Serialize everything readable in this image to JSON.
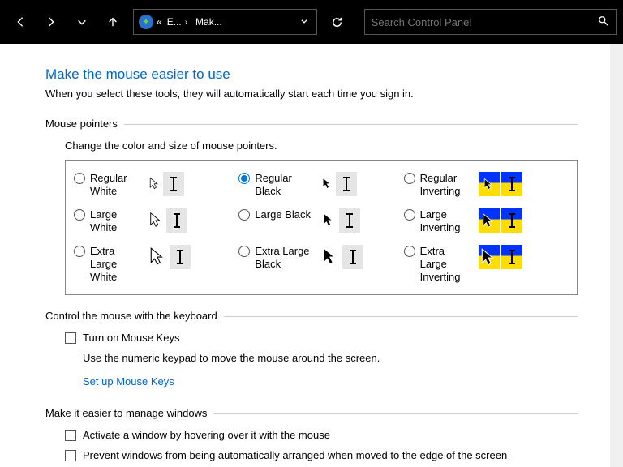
{
  "toolbar": {
    "breadcrumb1": "E...",
    "breadcrumb2": "Mak...",
    "search_placeholder": "Search Control Panel"
  },
  "page": {
    "title": "Make the mouse easier to use",
    "subtitle": "When you select these tools, they will automatically start each time you sign in."
  },
  "pointers": {
    "legend": "Mouse pointers",
    "instruction": "Change the color and size of mouse pointers.",
    "selected": "regular_black",
    "options": {
      "regular_white": "Regular White",
      "regular_black": "Regular Black",
      "regular_inverting": "Regular Inverting",
      "large_white": "Large White",
      "large_black": "Large Black",
      "large_inverting": "Large Inverting",
      "xl_white": "Extra Large White",
      "xl_black": "Extra Large Black",
      "xl_inverting": "Extra Large Inverting"
    }
  },
  "keyboard": {
    "legend": "Control the mouse with the keyboard",
    "mousekeys_label": "Turn on Mouse Keys",
    "mousekeys_help": "Use the numeric keypad to move the mouse around the screen.",
    "setup_link": "Set up Mouse Keys"
  },
  "windows": {
    "legend": "Make it easier to manage windows",
    "hover_label": "Activate a window by hovering over it with the mouse",
    "snap_label": "Prevent windows from being automatically arranged when moved to the edge of the screen"
  }
}
